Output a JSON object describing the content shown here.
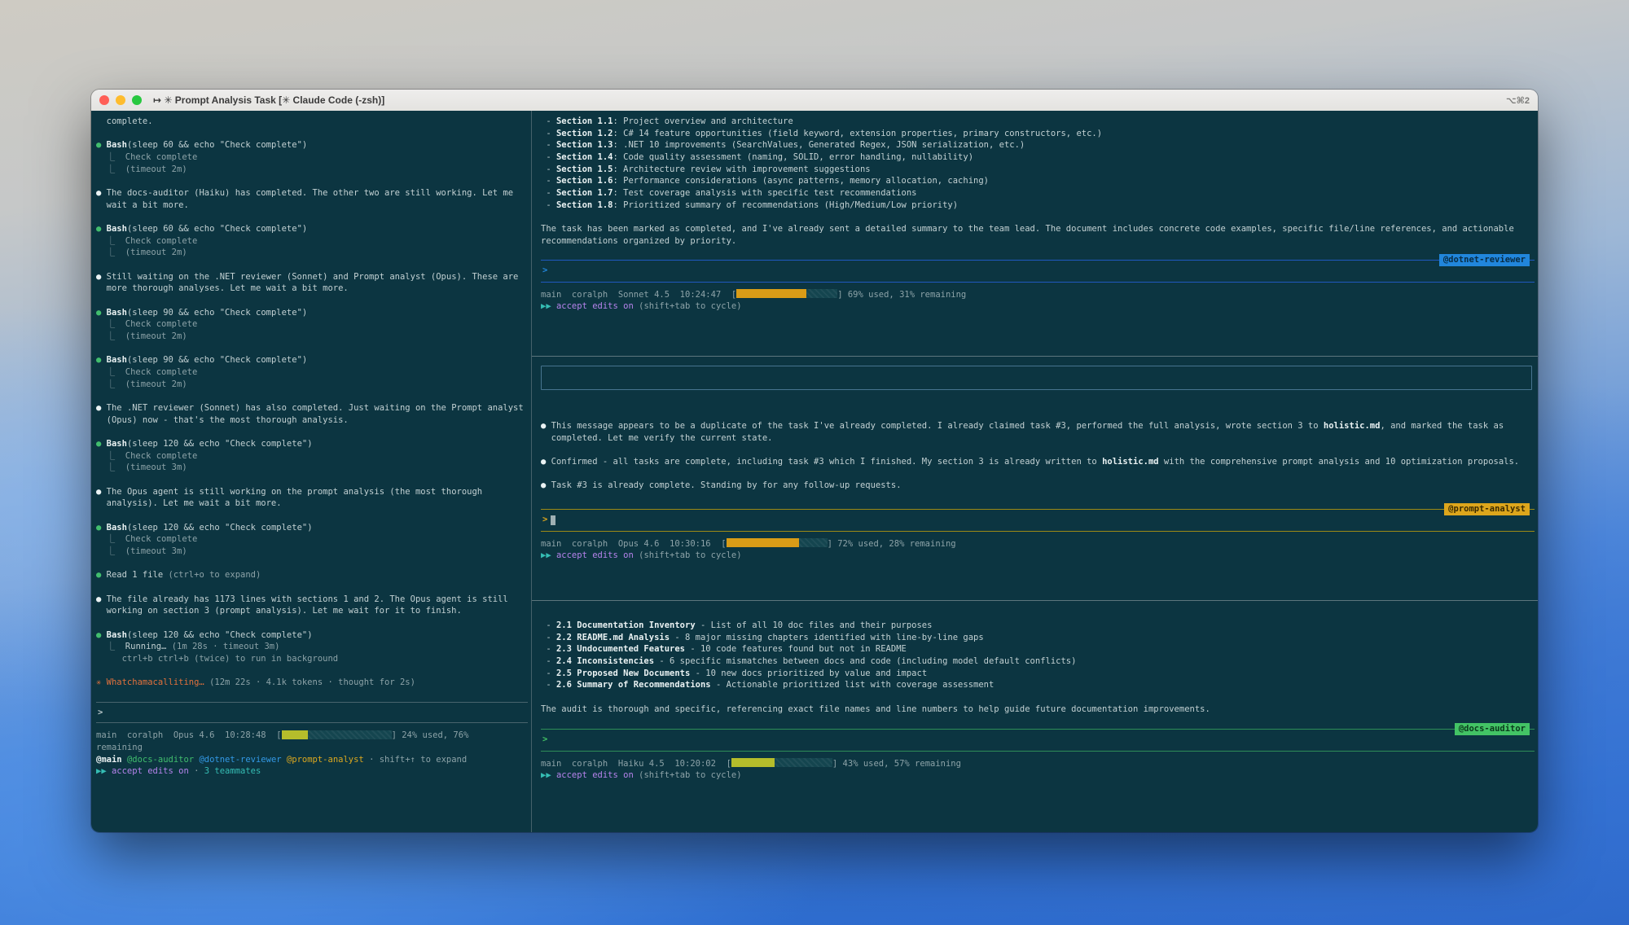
{
  "window": {
    "title": "↦ ✳ Prompt Analysis Task [✳ Claude Code (-zsh)]",
    "shortcut": "⌥⌘2"
  },
  "left_pane": {
    "lines": [
      [
        [
          "fg",
          "  complete."
        ]
      ],
      [],
      [
        [
          "green",
          "● "
        ],
        [
          "bright",
          "Bash"
        ],
        [
          "fg",
          "(sleep 60 && echo \"Check complete\")"
        ]
      ],
      [
        [
          "dim",
          "  ⎿  Check complete"
        ]
      ],
      [
        [
          "dim",
          "  ⎿  (timeout 2m)"
        ]
      ],
      [],
      [
        [
          "bright",
          "● "
        ],
        [
          "fg",
          "The docs-auditor (Haiku) has completed. The other two are still working. Let me"
        ]
      ],
      [
        [
          "fg",
          "  wait a bit more."
        ]
      ],
      [],
      [
        [
          "green",
          "● "
        ],
        [
          "bright",
          "Bash"
        ],
        [
          "fg",
          "(sleep 60 && echo \"Check complete\")"
        ]
      ],
      [
        [
          "dim",
          "  ⎿  Check complete"
        ]
      ],
      [
        [
          "dim",
          "  ⎿  (timeout 2m)"
        ]
      ],
      [],
      [
        [
          "bright",
          "● "
        ],
        [
          "fg",
          "Still waiting on the .NET reviewer (Sonnet) and Prompt analyst (Opus). These are"
        ]
      ],
      [
        [
          "fg",
          "  more thorough analyses. Let me wait a bit more."
        ]
      ],
      [],
      [
        [
          "green",
          "● "
        ],
        [
          "bright",
          "Bash"
        ],
        [
          "fg",
          "(sleep 90 && echo \"Check complete\")"
        ]
      ],
      [
        [
          "dim",
          "  ⎿  Check complete"
        ]
      ],
      [
        [
          "dim",
          "  ⎿  (timeout 2m)"
        ]
      ],
      [],
      [
        [
          "green",
          "● "
        ],
        [
          "bright",
          "Bash"
        ],
        [
          "fg",
          "(sleep 90 && echo \"Check complete\")"
        ]
      ],
      [
        [
          "dim",
          "  ⎿  Check complete"
        ]
      ],
      [
        [
          "dim",
          "  ⎿  (timeout 2m)"
        ]
      ],
      [],
      [
        [
          "bright",
          "● "
        ],
        [
          "fg",
          "The .NET reviewer (Sonnet) has also completed. Just waiting on the Prompt analyst"
        ]
      ],
      [
        [
          "fg",
          "  (Opus) now - that's the most thorough analysis."
        ]
      ],
      [],
      [
        [
          "green",
          "● "
        ],
        [
          "bright",
          "Bash"
        ],
        [
          "fg",
          "(sleep 120 && echo \"Check complete\")"
        ]
      ],
      [
        [
          "dim",
          "  ⎿  Check complete"
        ]
      ],
      [
        [
          "dim",
          "  ⎿  (timeout 3m)"
        ]
      ],
      [],
      [
        [
          "bright",
          "● "
        ],
        [
          "fg",
          "The Opus agent is still working on the prompt analysis (the most thorough"
        ]
      ],
      [
        [
          "fg",
          "  analysis). Let me wait a bit more."
        ]
      ],
      [],
      [
        [
          "green",
          "● "
        ],
        [
          "bright",
          "Bash"
        ],
        [
          "fg",
          "(sleep 120 && echo \"Check complete\")"
        ]
      ],
      [
        [
          "dim",
          "  ⎿  Check complete"
        ]
      ],
      [
        [
          "dim",
          "  ⎿  (timeout 3m)"
        ]
      ],
      [],
      [
        [
          "green",
          "● "
        ],
        [
          "fg",
          "Read 1 file "
        ],
        [
          "dim",
          "(ctrl+o to expand)"
        ]
      ],
      [],
      [
        [
          "bright",
          "● "
        ],
        [
          "fg",
          "The file already has 1173 lines with sections 1 and 2. The Opus agent is still"
        ]
      ],
      [
        [
          "fg",
          "  working on section 3 (prompt analysis). Let me wait for it to finish."
        ]
      ],
      [],
      [
        [
          "green",
          "● "
        ],
        [
          "bright",
          "Bash"
        ],
        [
          "fg",
          "(sleep 120 && echo \"Check complete\")"
        ]
      ],
      [
        [
          "dim",
          "  ⎿  "
        ],
        [
          "fg",
          "Running… "
        ],
        [
          "dim",
          "(1m 28s · timeout 3m)"
        ]
      ],
      [
        [
          "dim",
          "     ctrl+b ctrl+b (twice) to run in background"
        ]
      ],
      [],
      [
        [
          "orange",
          "✳ Whatchamacalliting… "
        ],
        [
          "dim",
          "(12m 22s · 4.1k tokens · thought for 2s)"
        ]
      ]
    ],
    "prompt": ">",
    "status_pre": [
      [
        "dim",
        "main  coralph  Opus 4.6  10:28:48  ["
      ]
    ],
    "bar": {
      "pct": 24,
      "color": "#b5bd2b"
    },
    "status_post": [
      [
        "dim",
        "] 24% used, 76%"
      ]
    ],
    "status_wrap": [
      [
        "dim",
        "remaining"
      ]
    ],
    "teammates_line": [
      [
        "bright",
        "@main "
      ],
      [
        "green",
        "@docs-auditor "
      ],
      [
        "blue",
        "@dotnet-reviewer "
      ],
      [
        "amber",
        "@prompt-analyst"
      ],
      [
        "dim",
        " · shift+↑ to expand"
      ]
    ],
    "accept_line": [
      [
        "teal",
        "▶▶ "
      ],
      [
        "purple",
        "accept edits on"
      ],
      [
        "dim",
        " · "
      ],
      [
        "teal",
        "3 teammates"
      ]
    ]
  },
  "panes": [
    {
      "badge": "@dotnet-reviewer",
      "accent": "#2186dc",
      "line_color": "#2058bf",
      "badge_fg": "#082c44",
      "prompt": ">",
      "lines": [
        [
          [
            "fg",
            " - "
          ],
          [
            "bright",
            "Section 1.1"
          ],
          [
            "fg",
            ": Project overview and architecture"
          ]
        ],
        [
          [
            "fg",
            " - "
          ],
          [
            "bright",
            "Section 1.2"
          ],
          [
            "fg",
            ": C# 14 feature opportunities (field keyword, extension properties, primary constructors, etc.)"
          ]
        ],
        [
          [
            "fg",
            " - "
          ],
          [
            "bright",
            "Section 1.3"
          ],
          [
            "fg",
            ": .NET 10 improvements (SearchValues, Generated Regex, JSON serialization, etc.)"
          ]
        ],
        [
          [
            "fg",
            " - "
          ],
          [
            "bright",
            "Section 1.4"
          ],
          [
            "fg",
            ": Code quality assessment (naming, SOLID, error handling, nullability)"
          ]
        ],
        [
          [
            "fg",
            " - "
          ],
          [
            "bright",
            "Section 1.5"
          ],
          [
            "fg",
            ": Architecture review with improvement suggestions"
          ]
        ],
        [
          [
            "fg",
            " - "
          ],
          [
            "bright",
            "Section 1.6"
          ],
          [
            "fg",
            ": Performance considerations (async patterns, memory allocation, caching)"
          ]
        ],
        [
          [
            "fg",
            " - "
          ],
          [
            "bright",
            "Section 1.7"
          ],
          [
            "fg",
            ": Test coverage analysis with specific test recommendations"
          ]
        ],
        [
          [
            "fg",
            " - "
          ],
          [
            "bright",
            "Section 1.8"
          ],
          [
            "fg",
            ": Prioritized summary of recommendations (High/Medium/Low priority)"
          ]
        ],
        [],
        [
          [
            "fg",
            "The task has been marked as completed, and I've already sent a detailed summary to the team lead. The document includes concrete code examples, specific file/line references, and actionable"
          ]
        ],
        [
          [
            "fg",
            "recommendations organized by priority."
          ]
        ]
      ],
      "status_pre": [
        [
          "dim",
          "main  coralph  Sonnet 4.5  10:24:47  ["
        ]
      ],
      "bar": {
        "pct": 69,
        "color": "#d99c17"
      },
      "status_post": [
        [
          "dim",
          "] 69% used, 31% remaining"
        ]
      ],
      "accept_line": [
        [
          "teal",
          "▶▶ "
        ],
        [
          "purple",
          "accept edits on"
        ],
        [
          "dim",
          " (shift+tab to cycle)"
        ]
      ]
    },
    {
      "badge": "@prompt-analyst",
      "accent": "#dda61c",
      "line_color": "#9c8a16",
      "badge_fg": "#3b2b00",
      "prompt": ">",
      "lines": [
        [
          [
            "bright",
            "● "
          ],
          [
            "fg",
            "This message appears to be a duplicate of the task I've already completed. I already claimed task #3, performed the full analysis, wrote section 3 to "
          ],
          [
            "bright",
            "holistic.md"
          ],
          [
            "fg",
            ", and marked the task as"
          ]
        ],
        [
          [
            "fg",
            "  completed. Let me verify the current state."
          ]
        ],
        [],
        [
          [
            "bright",
            "● "
          ],
          [
            "fg",
            "Confirmed - all tasks are complete, including task #3 which I finished. My section 3 is already written to "
          ],
          [
            "bright",
            "holistic.md"
          ],
          [
            "fg",
            " with the comprehensive prompt analysis and 10 optimization proposals."
          ]
        ],
        [],
        [
          [
            "bright",
            "● "
          ],
          [
            "fg",
            "Task #3 is already complete. Standing by for any follow-up requests."
          ]
        ]
      ],
      "status_pre": [
        [
          "dim",
          "main  coralph  Opus 4.6  10:30:16  ["
        ]
      ],
      "bar": {
        "pct": 72,
        "color": "#d99c17"
      },
      "status_post": [
        [
          "dim",
          "] 72% used, 28% remaining"
        ]
      ],
      "accept_line": [
        [
          "teal",
          "▶▶ "
        ],
        [
          "purple",
          "accept edits on"
        ],
        [
          "dim",
          " (shift+tab to cycle)"
        ]
      ]
    },
    {
      "badge": "@docs-auditor",
      "accent": "#43c365",
      "line_color": "#2e8d57",
      "badge_fg": "#0a3a1c",
      "prompt": ">",
      "lines": [
        [
          [
            "fg",
            " - "
          ],
          [
            "bright",
            "2.1 Documentation Inventory"
          ],
          [
            "fg",
            " - List of all 10 doc files and their purposes"
          ]
        ],
        [
          [
            "fg",
            " - "
          ],
          [
            "bright",
            "2.2 README.md Analysis"
          ],
          [
            "fg",
            " - 8 major missing chapters identified with line-by-line gaps"
          ]
        ],
        [
          [
            "fg",
            " - "
          ],
          [
            "bright",
            "2.3 Undocumented Features"
          ],
          [
            "fg",
            " - 10 code features found but not in README"
          ]
        ],
        [
          [
            "fg",
            " - "
          ],
          [
            "bright",
            "2.4 Inconsistencies"
          ],
          [
            "fg",
            " - 6 specific mismatches between docs and code (including model default conflicts)"
          ]
        ],
        [
          [
            "fg",
            " - "
          ],
          [
            "bright",
            "2.5 Proposed New Documents"
          ],
          [
            "fg",
            " - 10 new docs prioritized by value and impact"
          ]
        ],
        [
          [
            "fg",
            " - "
          ],
          [
            "bright",
            "2.6 Summary of Recommendations"
          ],
          [
            "fg",
            " - Actionable prioritized list with coverage assessment"
          ]
        ],
        [],
        [
          [
            "fg",
            "The audit is thorough and specific, referencing exact file names and line numbers to help guide future documentation improvements."
          ]
        ]
      ],
      "status_pre": [
        [
          "dim",
          "main  coralph  Haiku 4.5  10:20:02  ["
        ]
      ],
      "bar": {
        "pct": 43,
        "color": "#b5bd2b"
      },
      "status_post": [
        [
          "dim",
          "] 43% used, 57% remaining"
        ]
      ],
      "accept_line": [
        [
          "teal",
          "▶▶ "
        ],
        [
          "purple",
          "accept edits on"
        ],
        [
          "dim",
          " (shift+tab to cycle)"
        ]
      ]
    }
  ]
}
